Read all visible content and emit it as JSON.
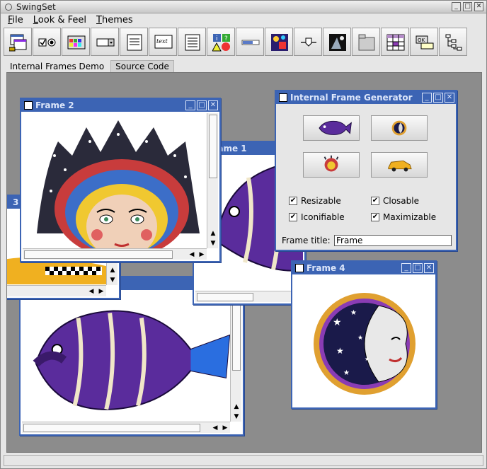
{
  "app": {
    "title": "SwingSet"
  },
  "window_controls": {
    "minimize": "_",
    "maximize": "□",
    "close": "✕"
  },
  "menu": [
    "File",
    "Look & Feel",
    "Themes"
  ],
  "toolbar_icons": [
    "internal-frame-icon",
    "checkbox-radio-icon",
    "color-chooser-icon",
    "combobox-icon",
    "file-chooser-icon",
    "editor-pane-icon",
    "list-icon",
    "option-pane-icon",
    "progress-bar-icon",
    "scroll-pane-icon",
    "slider-icon",
    "split-pane-icon",
    "tabbed-pane-icon",
    "table-icon",
    "tooltip-icon",
    "tree-icon"
  ],
  "tabs": [
    {
      "label": "Internal Frames Demo",
      "active": true
    },
    {
      "label": "Source Code",
      "active": false
    }
  ],
  "frames": {
    "frame1": {
      "title": "Frame 1"
    },
    "frame2": {
      "title": "Frame 2"
    },
    "frame3": {
      "title": "3"
    },
    "frame4": {
      "title": "Frame 4"
    },
    "generator": {
      "title": "Internal Frame Generator",
      "options": [
        {
          "label": "Resizable",
          "checked": true
        },
        {
          "label": "Closable",
          "checked": true
        },
        {
          "label": "Iconifiable",
          "checked": true
        },
        {
          "label": "Maximizable",
          "checked": true
        }
      ],
      "frame_title_label": "Frame title:",
      "frame_title_value": "Frame"
    }
  },
  "colors": {
    "frame_title_bg": "#3c64b4",
    "frame_title_text": "#dce6fa",
    "desktop_bg": "#8c8c8c",
    "fish_purple": "#5a2c9c",
    "fish_stripe": "#f0e6c8"
  }
}
